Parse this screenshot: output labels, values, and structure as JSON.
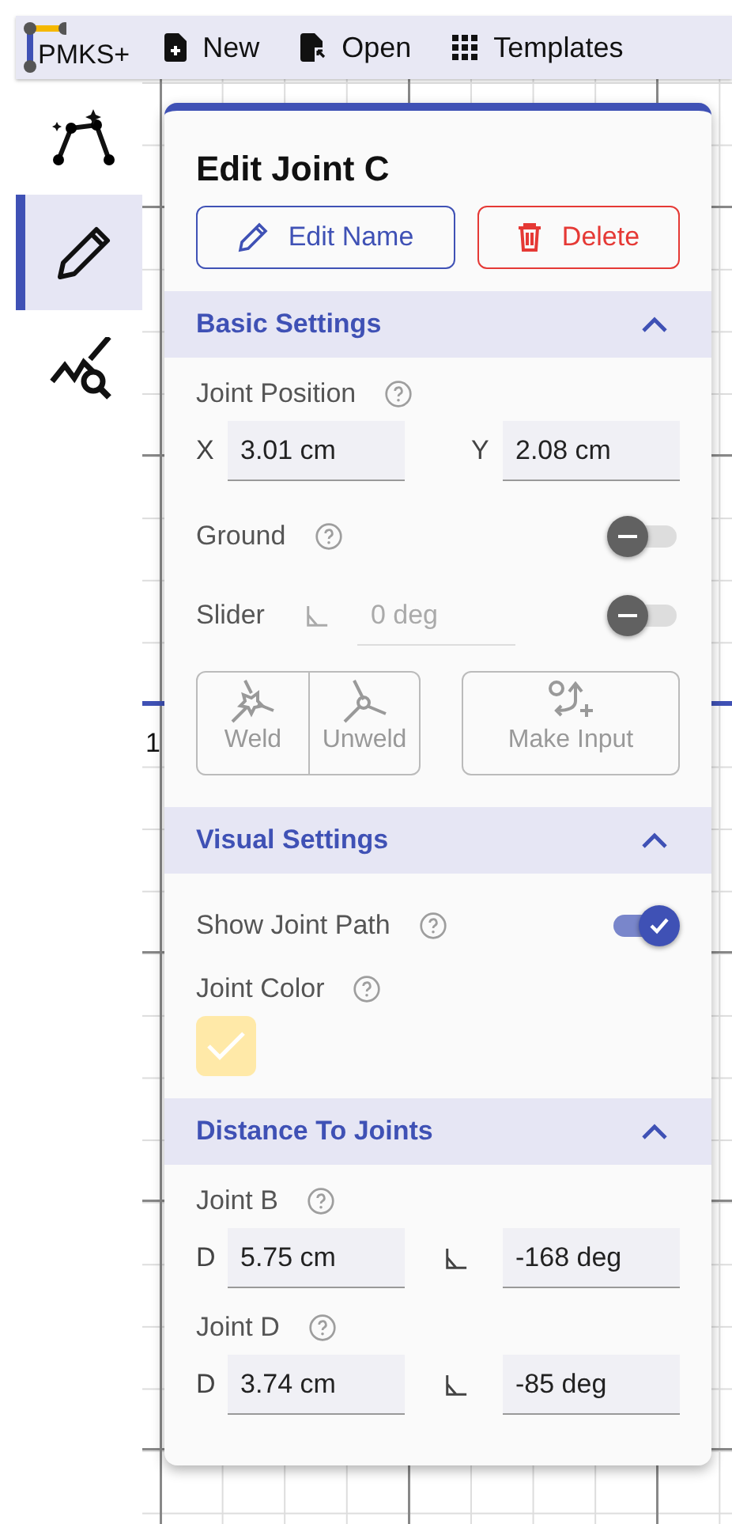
{
  "toolbar": {
    "logo": "PMKS+",
    "buttons": [
      {
        "label": "New",
        "kind": "new"
      },
      {
        "label": "Open",
        "kind": "open"
      },
      {
        "label": "Templates",
        "kind": "templates"
      }
    ]
  },
  "sidebar": {
    "items": [
      {
        "kind": "synthesis",
        "selected": false
      },
      {
        "kind": "edit",
        "selected": true
      },
      {
        "kind": "analysis",
        "selected": false
      }
    ]
  },
  "canvas": {
    "axis_label": "1"
  },
  "panel": {
    "title": "Edit Joint C",
    "actions": [
      {
        "label": "Edit Name",
        "kind": "edit"
      },
      {
        "label": "Delete",
        "kind": "delete"
      }
    ],
    "sections": [
      {
        "title": "Basic Settings",
        "expanded": true,
        "rows": [
          {
            "kind": "position",
            "label": "Joint Position",
            "help": true,
            "fields": [
              {
                "prefix": "X",
                "value": "3.01 cm"
              },
              {
                "prefix": "Y",
                "value": "2.08 cm"
              }
            ]
          },
          {
            "kind": "toggle",
            "label": "Ground",
            "help": true,
            "on": false
          },
          {
            "kind": "slider",
            "label": "Slider",
            "placeholder": "0 deg",
            "disabled": true,
            "on": false
          },
          {
            "kind": "tools",
            "groups": [
              [
                {
                  "label": "Weld",
                  "kind": "weld",
                  "disabled": true
                },
                {
                  "label": "Unweld",
                  "kind": "unweld",
                  "disabled": true
                }
              ],
              [
                {
                  "label": "Make Input",
                  "kind": "input",
                  "disabled": true
                }
              ]
            ]
          }
        ]
      },
      {
        "title": "Visual Settings",
        "expanded": true,
        "rows": [
          {
            "kind": "toggle",
            "label": "Show Joint Path",
            "help": true,
            "on": true
          },
          {
            "kind": "color",
            "label": "Joint Color",
            "help": true,
            "color": "#ffe9a8",
            "selected": true
          }
        ]
      },
      {
        "title": "Distance To Joints",
        "expanded": true,
        "rows": [
          {
            "kind": "distance",
            "label": "Joint B",
            "help": true,
            "distance_prefix": "D",
            "distance": "5.75 cm",
            "angle": "-168 deg"
          },
          {
            "kind": "distance",
            "label": "Joint D",
            "help": true,
            "distance_prefix": "D",
            "distance": "3.74 cm",
            "angle": "-85 deg"
          }
        ]
      }
    ]
  }
}
